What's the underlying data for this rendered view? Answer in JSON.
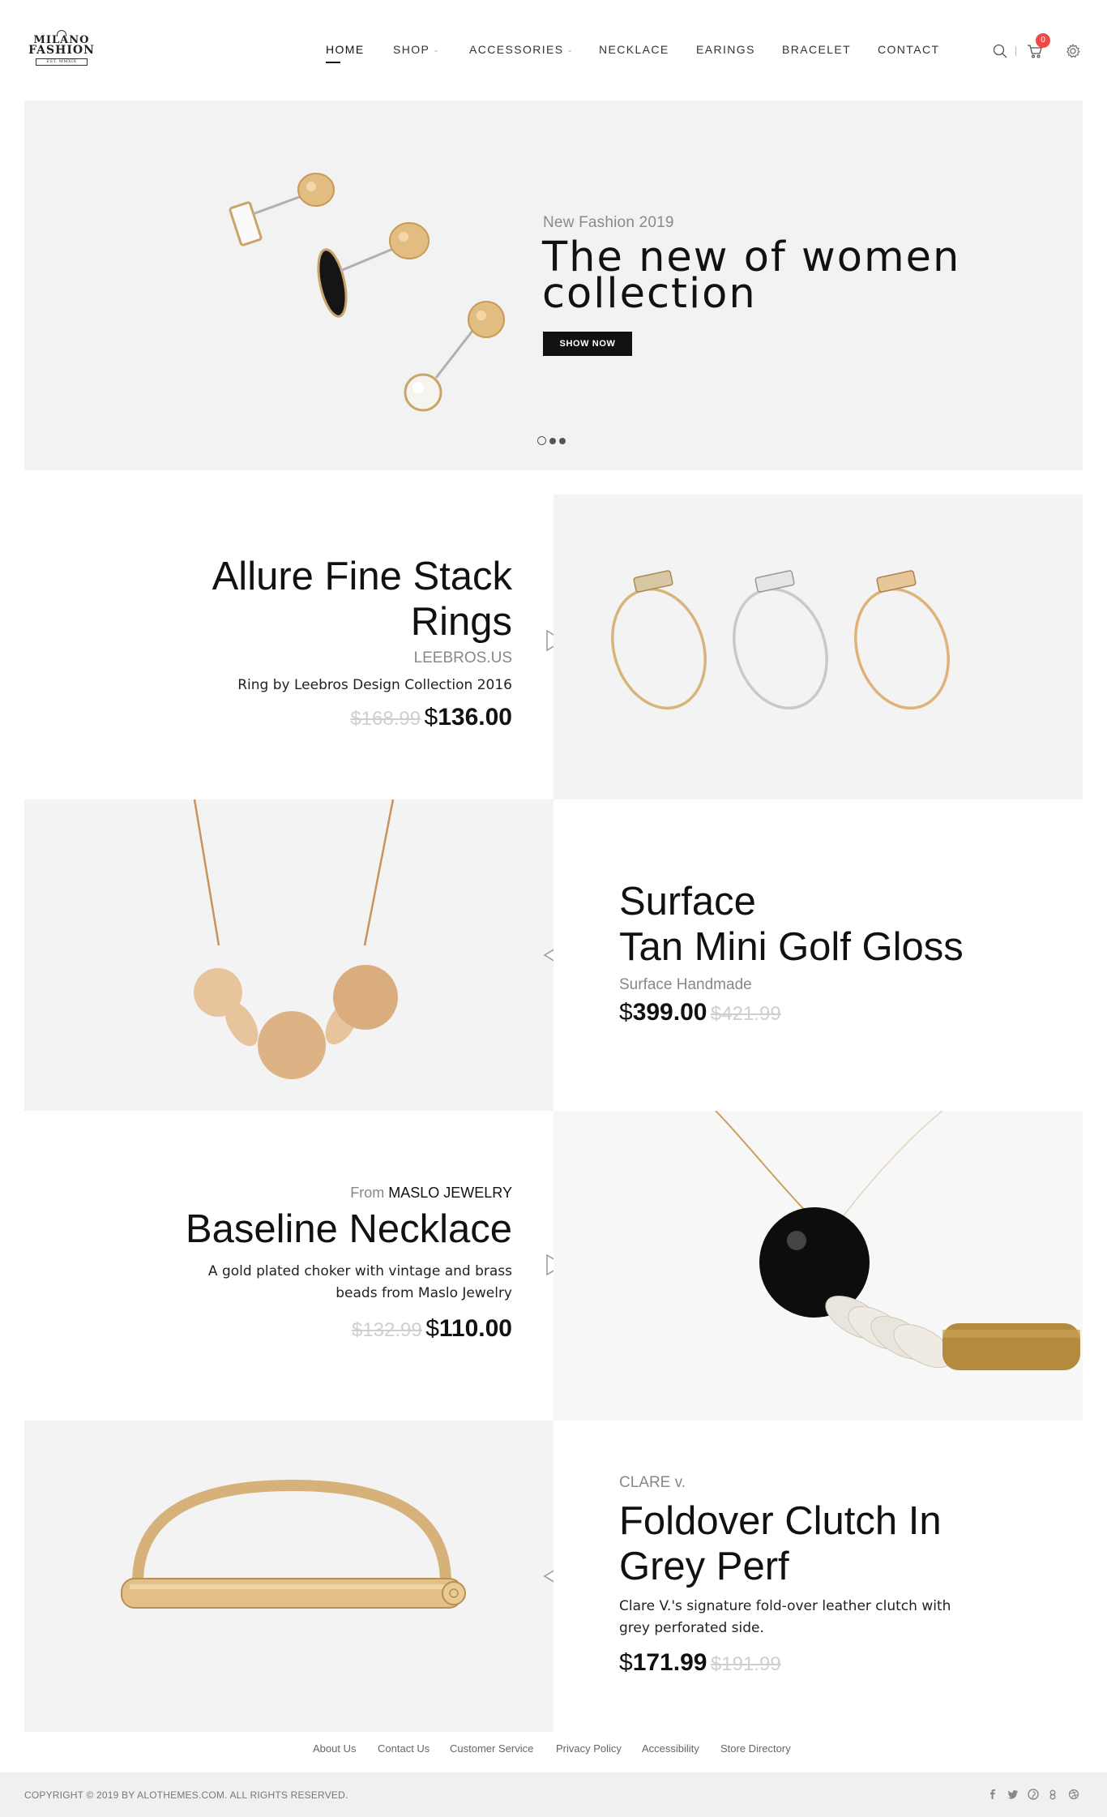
{
  "logo": {
    "line1": "MILANO",
    "line2": "FASHION",
    "line3": "EST. MMXIX"
  },
  "nav": {
    "items": [
      {
        "label": "HOME",
        "active": true
      },
      {
        "label": "SHOP",
        "dropdown": true
      },
      {
        "label": "ACCESSORIES",
        "dropdown": true
      },
      {
        "label": "NECKLACE"
      },
      {
        "label": "EARINGS"
      },
      {
        "label": "BRACELET"
      },
      {
        "label": "CONTACT"
      }
    ],
    "cart_count": "0",
    "icons": [
      "search-icon",
      "cart-icon",
      "gear-icon"
    ],
    "badge_color": "#ef4a45"
  },
  "hero": {
    "subtitle": "New Fashion 2019",
    "title": "The new of women collection",
    "button": "SHOW NOW",
    "slides": 3,
    "active_slide": 1
  },
  "products": [
    {
      "title": "Allure Fine Stack Rings",
      "brand": "LEEBROS.US",
      "desc": "Ring by Leebros Design Collection 2016",
      "old_price": "$168.99",
      "currency": "$",
      "price": "136.00",
      "arrow": "play-right-icon"
    },
    {
      "title_line1": "Surface",
      "title_line2": "Tan Mini Golf Gloss",
      "brand": "Surface Handmade",
      "currency": "$",
      "price": "399.00",
      "old_price": "$421.99",
      "arrow": "play-left-icon"
    },
    {
      "from_label": "From",
      "brand": "MASLO JEWELRY",
      "title": "Baseline Necklace",
      "desc": "A gold plated choker with vintage and brass beads from Maslo Jewelry",
      "old_price": "$132.99",
      "currency": "$",
      "price": "110.00",
      "arrow": "play-right-icon"
    },
    {
      "brand": "CLARE v.",
      "title": "Foldover Clutch In Grey Perf",
      "desc": "Clare V.'s signature fold-over leather clutch with grey perforated side.",
      "currency": "$",
      "price": "171.99",
      "old_price": "$191.99",
      "arrow": "play-left-icon"
    }
  ],
  "footer": {
    "links": [
      "About Us",
      "Contact Us",
      "Customer Service",
      "Privacy Policy",
      "Accessibility",
      "Store Directory"
    ],
    "copyright": "COPYRIGHT © 2019 BY ALOTHEMES.COM. ALL RIGHTS RESERVED.",
    "social": [
      "facebook-icon",
      "twitter-icon",
      "pinterest-icon",
      "google-plus-icon",
      "dribbble-icon"
    ]
  }
}
